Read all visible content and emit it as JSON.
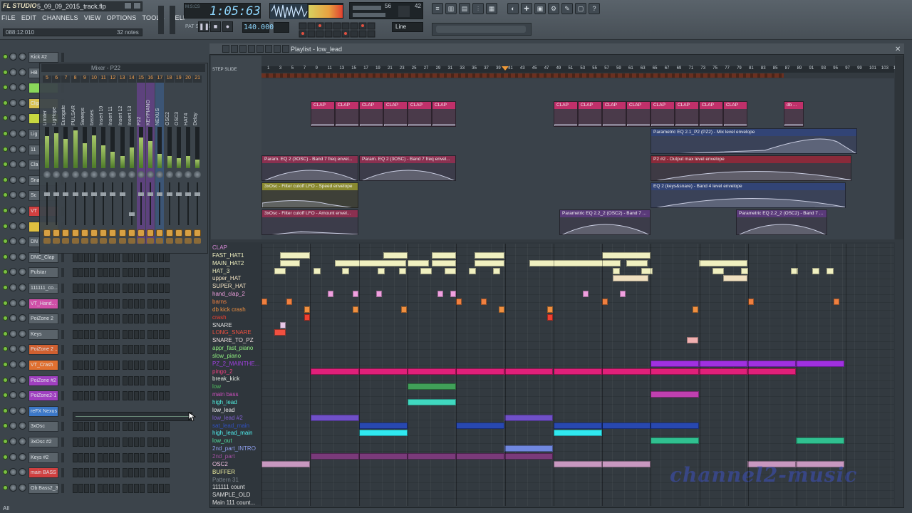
{
  "titlebar": {
    "app_logo": "FL STUDIO",
    "project": "5_09_09_2015_track.flp"
  },
  "menu": [
    "FILE",
    "EDIT",
    "CHANNELS",
    "VIEW",
    "OPTIONS",
    "TOOLS",
    "HELP"
  ],
  "hint_bar": {
    "left": "088:12:010",
    "right": "32 notes"
  },
  "transport": {
    "time": "1:05:63",
    "time_label": "M:S:CS",
    "mode_label": "PAT SONG",
    "tempo": "140.000",
    "snap": "Line",
    "cpu": "56",
    "poly": "42"
  },
  "playlist": {
    "title": "Playlist - low_lead",
    "side_label": "STEP  SLIDE"
  },
  "ruler_numbers": [
    "1",
    "3",
    "5",
    "7",
    "9",
    "11",
    "13",
    "15",
    "17",
    "19",
    "21",
    "23",
    "25",
    "27",
    "29",
    "31",
    "33",
    "35",
    "37",
    "39",
    "41",
    "43",
    "45",
    "47",
    "49",
    "51",
    "53",
    "55",
    "57",
    "59",
    "61",
    "63",
    "65",
    "67",
    "69",
    "71",
    "73",
    "75",
    "77",
    "79",
    "81",
    "83",
    "85",
    "87",
    "89",
    "91",
    "93",
    "95",
    "97",
    "99",
    "101",
    "103",
    "105"
  ],
  "clip_labels": {
    "clap": "CLAP",
    "db": "db ...",
    "eq_mix": "Parametric EQ 2.1_P2 (PZ2) - Mix level envelope",
    "param_eq_3osc": "Param. EQ 2 (3OSC) - Band 7 freq envel...",
    "p2_output": "P2 #2 - Output max level envelope",
    "lfo_speed": "3xOsc - Filter cutoff LFO - Speed envelope",
    "eq_keys": "EQ 2 (keys&snare) - Band 4 level envelope",
    "lfo_amount": "3xOsc - Filter cutoff LFO - Amount envel...",
    "param_eq_osc2": "Parametric EQ 2.2_2 (OSC2) - Band 7 ..."
  },
  "channels": [
    {
      "name": "Kick #2",
      "color": "#5a636a"
    },
    {
      "name": "HB",
      "color": "#5a636a"
    },
    {
      "name": "",
      "color": "#8ad85a"
    },
    {
      "name": "Clip",
      "color": "#d8c050"
    },
    {
      "name": "",
      "color": "#c8d840"
    },
    {
      "name": "Lig",
      "color": "#5a636a"
    },
    {
      "name": "11",
      "color": "#5a636a"
    },
    {
      "name": "Cla",
      "color": "#5a636a"
    },
    {
      "name": "Sna",
      "color": "#5a636a"
    },
    {
      "name": "Sc",
      "color": "#5a636a"
    },
    {
      "name": "VT",
      "color": "#d04040"
    },
    {
      "name": "",
      "color": "#e0c040"
    },
    {
      "name": "DN",
      "color": "#5a636a"
    },
    {
      "name": "DNC_Clap",
      "color": "#5a636a"
    },
    {
      "name": "Pulstar",
      "color": "#5a636a"
    },
    {
      "name": "111111_co...",
      "color": "#5a636a"
    },
    {
      "name": "VT_Hand...",
      "color": "#d050a8"
    },
    {
      "name": "PoiZone 2",
      "color": "#5a636a"
    },
    {
      "name": "Keys",
      "color": "#5a636a"
    },
    {
      "name": "PoiZone 2 ...",
      "color": "#d06030"
    },
    {
      "name": "VT_Crash",
      "color": "#e07030"
    },
    {
      "name": "PoiZone #2",
      "color": "#a040c0"
    },
    {
      "name": "PoiZone2-1",
      "color": "#a040c0"
    },
    {
      "name": "reFX Nexus",
      "color": "#3c78c8"
    },
    {
      "name": "3xOsc",
      "color": "#5a636a"
    },
    {
      "name": "3xOsc #2",
      "color": "#5a636a"
    },
    {
      "name": "Keys #2",
      "color": "#5a636a"
    },
    {
      "name": "main BASS",
      "color": "#d04040"
    },
    {
      "name": "Ob Bass2_3",
      "color": "#5a636a"
    }
  ],
  "mixer": {
    "title": "Mixer - P22",
    "strips": [
      {
        "num": "5",
        "name": "Limiter"
      },
      {
        "num": "6",
        "name": "LigHope"
      },
      {
        "num": "7",
        "name": "Eurogate"
      },
      {
        "num": "8",
        "name": "PULSAR"
      },
      {
        "num": "9",
        "name": "Sweeps"
      },
      {
        "num": "10",
        "name": "basses"
      },
      {
        "num": "11",
        "name": "Insert 10"
      },
      {
        "num": "12",
        "name": "Insert 11"
      },
      {
        "num": "13",
        "name": "Insert 12"
      },
      {
        "num": "14",
        "name": "Insert 13"
      },
      {
        "num": "15",
        "name": "P22"
      },
      {
        "num": "16",
        "name": "KEYPIANO"
      },
      {
        "num": "17",
        "name": "NEXUS"
      },
      {
        "num": "18",
        "name": "OSC2"
      },
      {
        "num": "19",
        "name": "OSC3"
      },
      {
        "num": "20",
        "name": "HAT4"
      },
      {
        "num": "21",
        "name": "Delay"
      }
    ]
  },
  "pattern_tracks": [
    {
      "name": "CLAP",
      "color": "#d88ad8"
    },
    {
      "name": "FAST_HAT1",
      "color": "#f0f0c0"
    },
    {
      "name": "MAIN_HAT2",
      "color": "#f0f0c0"
    },
    {
      "name": "HAT_3",
      "color": "#f0f0c0"
    },
    {
      "name": "upper_HAT",
      "color": "#f0e0c0"
    },
    {
      "name": "SUPER_HAT",
      "color": "#f0e0c0"
    },
    {
      "name": "hand_clap_2",
      "color": "#f0a0e0"
    },
    {
      "name": "barns",
      "color": "#f08040"
    },
    {
      "name": "db kick crash",
      "color": "#f09040"
    },
    {
      "name": "crash",
      "color": "#f04030"
    },
    {
      "name": "SNARE",
      "color": "#e0e0e0"
    },
    {
      "name": "LONG_SNARE",
      "color": "#f05040"
    },
    {
      "name": "SNARE_TO_PZ",
      "color": "#f0e0e0"
    },
    {
      "name": "appr_fast_piano",
      "color": "#90f080"
    },
    {
      "name": "slow_piano",
      "color": "#90f080"
    },
    {
      "name": "PZ_2_MAINTHE...",
      "color": "#a040e0"
    },
    {
      "name": "pingo_2",
      "color": "#f04080"
    },
    {
      "name": "break_kick",
      "color": "#e0e8e0"
    },
    {
      "name": "low",
      "color": "#50c060"
    },
    {
      "name": "main bass",
      "color": "#d050c0"
    },
    {
      "name": "high_lead",
      "color": "#50f0e0"
    },
    {
      "name": "low_lead",
      "color": "#f0f0f0"
    },
    {
      "name": "low_lead #2",
      "color": "#8060d0"
    },
    {
      "name": "sat_lead_main",
      "color": "#3050c0"
    },
    {
      "name": "high_lead_main",
      "color": "#50f0f0"
    },
    {
      "name": "low_out",
      "color": "#50e0a0"
    },
    {
      "name": "2nd_part_INTRO",
      "color": "#90a0f0"
    },
    {
      "name": "2nd_part",
      "color": "#a050a0"
    },
    {
      "name": "OSC2",
      "color": "#f0c0e0"
    },
    {
      "name": "BUFFER",
      "color": "#f0f0a0"
    },
    {
      "name": "Pattern 31",
      "color": "#7a848c"
    },
    {
      "name": "111111 count",
      "color": "#e0e0e0"
    },
    {
      "name": "SAMPLE_OLD",
      "color": "#e0e0e0"
    },
    {
      "name": "Main 111 count...",
      "color": "#e0e0e0"
    }
  ],
  "watermark": "channel2-music",
  "status": "All"
}
